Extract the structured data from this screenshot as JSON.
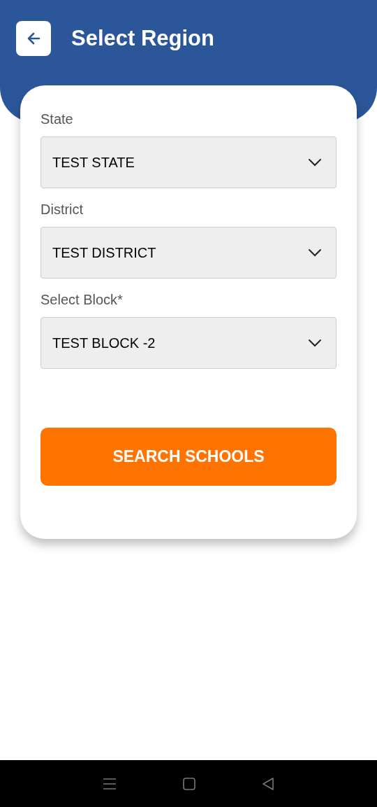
{
  "header": {
    "title": "Select Region"
  },
  "fields": [
    {
      "label": "State",
      "value": "TEST STATE"
    },
    {
      "label": "District",
      "value": "TEST DISTRICT"
    },
    {
      "label": "Select Block*",
      "value": "TEST BLOCK -2"
    }
  ],
  "button": {
    "label": "SEARCH SCHOOLS"
  }
}
